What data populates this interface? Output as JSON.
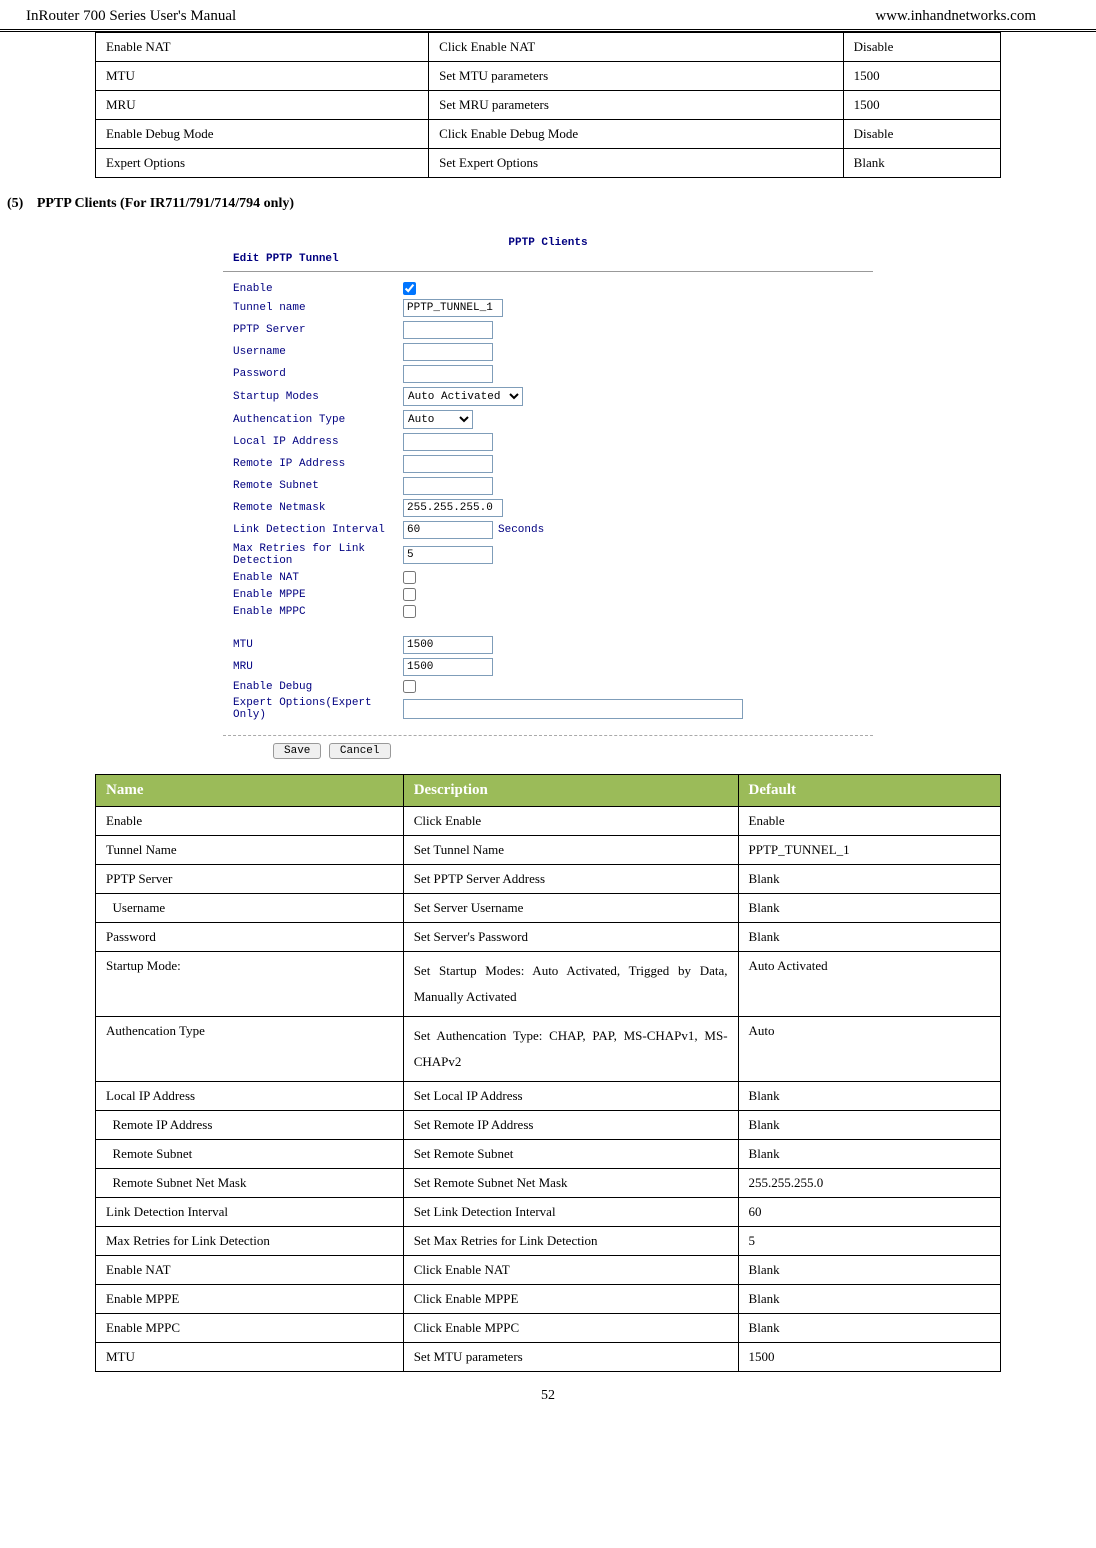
{
  "header": {
    "left": "InRouter 700 Series User's Manual",
    "right": "www.inhandnetworks.com"
  },
  "topTable": [
    {
      "c0": "Enable NAT",
      "c1": "Click Enable NAT",
      "c2": "Disable"
    },
    {
      "c0": "MTU",
      "c1": "Set MTU parameters",
      "c2": "1500"
    },
    {
      "c0": "MRU",
      "c1": "Set MRU parameters",
      "c2": "1500"
    },
    {
      "c0": "Enable Debug Mode",
      "c1": "Click Enable Debug Mode",
      "c2": "Disable"
    },
    {
      "c0": "Expert Options",
      "c1": "Set Expert Options",
      "c2": "Blank"
    }
  ],
  "sectionHeading": {
    "num": "(5)",
    "text": "PPTP Clients (For IR711/791/714/794 only)"
  },
  "form": {
    "title": "PPTP Clients",
    "subtitle": "Edit PPTP Tunnel",
    "rows": [
      {
        "label": "Enable",
        "type": "checkbox",
        "checked": true,
        "name": "enable-checkbox"
      },
      {
        "label": "Tunnel name",
        "type": "text",
        "value": "PPTP_TUNNEL_1",
        "width": "text100",
        "name": "tunnel-name-input"
      },
      {
        "label": "PPTP Server",
        "type": "text",
        "value": "",
        "width": "text90",
        "name": "pptp-server-input"
      },
      {
        "label": "Username",
        "type": "text",
        "value": "",
        "width": "text90",
        "name": "username-input"
      },
      {
        "label": "Password",
        "type": "text",
        "value": "",
        "width": "text90",
        "name": "password-input"
      },
      {
        "label": "Startup Modes",
        "type": "select",
        "value": "Auto Activated",
        "swidth": "120px",
        "name": "startup-modes-select"
      },
      {
        "label": "Authencation Type",
        "type": "select",
        "value": "Auto",
        "swidth": "70px",
        "name": "auth-type-select"
      },
      {
        "label": "Local IP Address",
        "type": "text",
        "value": "",
        "width": "text90",
        "name": "local-ip-input"
      },
      {
        "label": "Remote IP Address",
        "type": "text",
        "value": "",
        "width": "text90",
        "name": "remote-ip-input"
      },
      {
        "label": "Remote Subnet",
        "type": "text",
        "value": "",
        "width": "text90",
        "name": "remote-subnet-input"
      },
      {
        "label": "Remote Netmask",
        "type": "text",
        "value": "255.255.255.0",
        "width": "text100",
        "name": "remote-netmask-input"
      },
      {
        "label": "Link Detection Interval",
        "type": "text",
        "value": "60",
        "width": "text90",
        "after": "Seconds",
        "name": "link-detection-input"
      },
      {
        "label": "Max Retries for Link Detection",
        "type": "text",
        "value": "5",
        "width": "text90",
        "name": "max-retries-input"
      },
      {
        "label": "Enable NAT",
        "type": "checkbox",
        "checked": false,
        "name": "enable-nat-checkbox"
      },
      {
        "label": "Enable MPPE",
        "type": "checkbox",
        "checked": false,
        "name": "enable-mppe-checkbox"
      },
      {
        "label": "Enable MPPC",
        "type": "checkbox",
        "checked": false,
        "name": "enable-mppc-checkbox"
      }
    ],
    "rows2": [
      {
        "label": "MTU",
        "type": "text",
        "value": "1500",
        "width": "text90",
        "name": "mtu-input"
      },
      {
        "label": "MRU",
        "type": "text",
        "value": "1500",
        "width": "text90",
        "name": "mru-input"
      },
      {
        "label": "Enable Debug",
        "type": "checkbox",
        "checked": false,
        "name": "enable-debug-checkbox"
      },
      {
        "label": "Expert Options(Expert Only)",
        "type": "textarea",
        "value": "",
        "name": "expert-options-input"
      }
    ],
    "buttons": {
      "save": "Save",
      "cancel": "Cancel"
    }
  },
  "tableHeaders": {
    "c0": "Name",
    "c1": "Description",
    "c2": "Default"
  },
  "mainTable": [
    {
      "c0": "Enable",
      "c1": "Click Enable",
      "c2": "Enable"
    },
    {
      "c0": "Tunnel Name",
      "c1": "Set Tunnel Name",
      "c2": "PPTP_TUNNEL_1"
    },
    {
      "c0": "PPTP Server",
      "c1": "Set PPTP Server Address",
      "c2": "Blank"
    },
    {
      "c0": "  Username",
      "c1": "Set Server Username",
      "c2": "Blank"
    },
    {
      "c0": "Password",
      "c1": "Set Server's Password",
      "c2": "Blank"
    },
    {
      "c0": "Startup Mode:",
      "c1": "Set Startup Modes: Auto Activated, Trigged by Data, Manually Activated",
      "c2": "Auto Activated"
    },
    {
      "c0": "Authencation Type",
      "c1": "Set Authencation Type: CHAP, PAP, MS-CHAPv1, MS-CHAPv2",
      "c2": "Auto"
    },
    {
      "c0": "Local IP Address",
      "c1": "Set Local IP Address",
      "c2": "Blank"
    },
    {
      "c0": "  Remote IP Address",
      "c1": "Set Remote IP Address",
      "c2": "Blank"
    },
    {
      "c0": "  Remote Subnet",
      "c1": "Set Remote Subnet",
      "c2": "Blank"
    },
    {
      "c0": "  Remote Subnet Net Mask",
      "c1": "Set Remote Subnet Net Mask",
      "c2": "255.255.255.0"
    },
    {
      "c0": "Link Detection Interval",
      "c1": "Set Link Detection Interval",
      "c2": "60"
    },
    {
      "c0": "Max Retries for Link Detection",
      "c1": "Set Max Retries for Link Detection",
      "c2": "5"
    },
    {
      "c0": "Enable NAT",
      "c1": "Click Enable NAT",
      "c2": "Blank"
    },
    {
      "c0": "Enable MPPE",
      "c1": "Click Enable MPPE",
      "c2": "Blank"
    },
    {
      "c0": "Enable MPPC",
      "c1": "Click Enable MPPC",
      "c2": "Blank"
    },
    {
      "c0": "MTU",
      "c1": "Set MTU parameters",
      "c2": "1500"
    }
  ],
  "pageNumber": "52"
}
